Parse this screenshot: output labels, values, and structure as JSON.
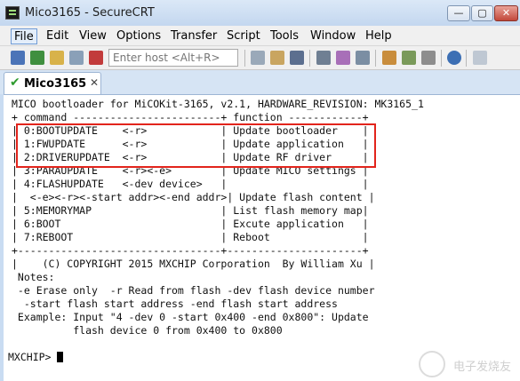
{
  "title_bar": {
    "title": "Mico3165 - SecureCRT"
  },
  "window_controls": {
    "min": "—",
    "max": "▢",
    "close": "✕"
  },
  "menu": [
    "File",
    "Edit",
    "View",
    "Options",
    "Transfer",
    "Script",
    "Tools",
    "Window",
    "Help"
  ],
  "toolbar": {
    "host_placeholder": "Enter host <Alt+R>"
  },
  "tab": {
    "label": "Mico3165",
    "check": "✔",
    "close": "✕"
  },
  "terminal": {
    "lines": [
      "MICO bootloader for MiCOKit-3165, v2.1, HARDWARE_REVISION: MK3165_1",
      "+ command ------------------------+ function ------------+",
      "| 0:BOOTUPDATE    <-r>            | Update bootloader    |",
      "| 1:FWUPDATE      <-r>            | Update application   |",
      "| 2:DRIVERUPDATE  <-r>            | Update RF driver     |",
      "| 3:PARAUPDATE    <-r><-e>        | Update MICO settings |",
      "| 4:FLASHUPDATE   <-dev device>   |                      |",
      "|  <-e><-r><-start addr><-end addr>| Update flash content |",
      "| 5:MEMORYMAP                     | List flash memory map|",
      "| 6:BOOT                          | Excute application   |",
      "| 7:REBOOT                        | Reboot               |",
      "+---------------------------------+----------------------+",
      "|    (C) COPYRIGHT 2015 MXCHIP Corporation  By William Xu |",
      " Notes:",
      " -e Erase only  -r Read from flash -dev flash device number",
      "  -start flash start address -end flash start address",
      " Example: Input \"4 -dev 0 -start 0x400 -end 0x800\": Update",
      "          flash device 0 from 0x400 to 0x800",
      "",
      "MXCHIP> "
    ]
  },
  "watermark": "电子发烧友"
}
